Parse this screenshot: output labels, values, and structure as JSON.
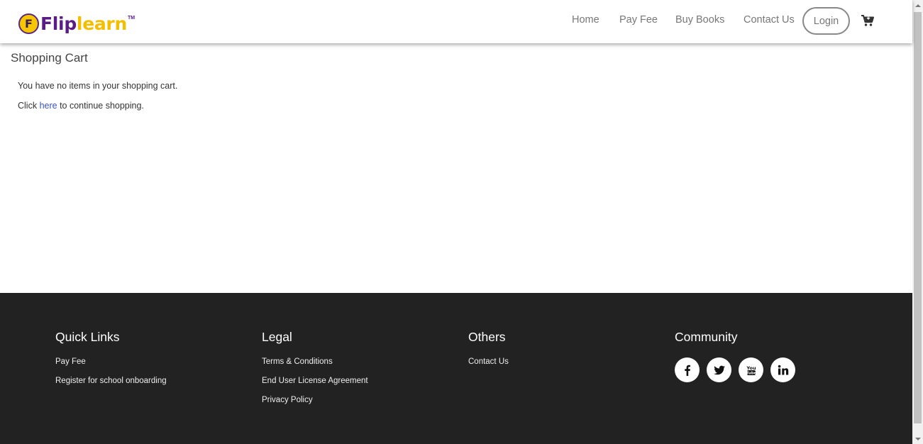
{
  "brand": {
    "name_part1": "Flip",
    "name_part2": "learn",
    "tm": "TM",
    "badge_letter": "F",
    "primary_color": "#5b1c87",
    "accent_color": "#f2be00"
  },
  "nav": {
    "items": [
      {
        "label": "Home"
      },
      {
        "label": "Pay Fee"
      },
      {
        "label": "Buy Books"
      },
      {
        "label": "Contact Us"
      }
    ],
    "login_label": "Login",
    "cart_icon": "shopping-cart-icon"
  },
  "main": {
    "title": "Shopping Cart",
    "empty_message": "You have no items in your shopping cart.",
    "continue_prefix": "Click ",
    "continue_link": "here",
    "continue_suffix": " to continue shopping."
  },
  "footer": {
    "quick_links": {
      "heading": "Quick Links",
      "items": [
        "Pay Fee",
        "Register for school onboarding"
      ]
    },
    "legal": {
      "heading": "Legal",
      "items": [
        "Terms & Conditions",
        "End User License Agreement",
        "Privacy Policy"
      ]
    },
    "others": {
      "heading": "Others",
      "items": [
        "Contact Us"
      ]
    },
    "community": {
      "heading": "Community",
      "icons": [
        "facebook-icon",
        "twitter-icon",
        "youtube-icon",
        "linkedin-icon"
      ]
    },
    "background": "#222222"
  }
}
